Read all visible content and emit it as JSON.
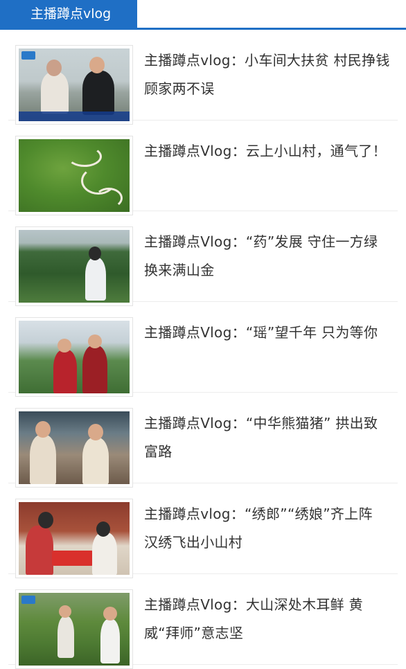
{
  "tabbar": {
    "active_tab": "主播蹲点vlog"
  },
  "articles": [
    {
      "title": "主播蹲点vlog：小车间大扶贫 村民挣钱顾家两不误",
      "thumb_icon": "factory-photo"
    },
    {
      "title": "主播蹲点Vlog：云上小山村，通气了！",
      "thumb_icon": "mountain-road-photo"
    },
    {
      "title": "主播蹲点Vlog：“药”发展 守住一方绿 换来满山金",
      "thumb_icon": "forest-photo"
    },
    {
      "title": "主播蹲点Vlog：“瑶”望千年 只为等你",
      "thumb_icon": "yao-costume-photo"
    },
    {
      "title": "主播蹲点Vlog：“中华熊猫猪” 拱出致富路",
      "thumb_icon": "interview-photo"
    },
    {
      "title": "主播蹲点vlog：“绣郎”“绣娘”齐上阵 汉绣飞出小山村",
      "thumb_icon": "embroidery-photo"
    },
    {
      "title": "主播蹲点Vlog：大山深处木耳鲜 黄威“拜师”意志坚",
      "thumb_icon": "field-photo"
    }
  ],
  "colors": {
    "accent": "#1f6fc5",
    "text": "#333333",
    "divider": "#ececec"
  }
}
